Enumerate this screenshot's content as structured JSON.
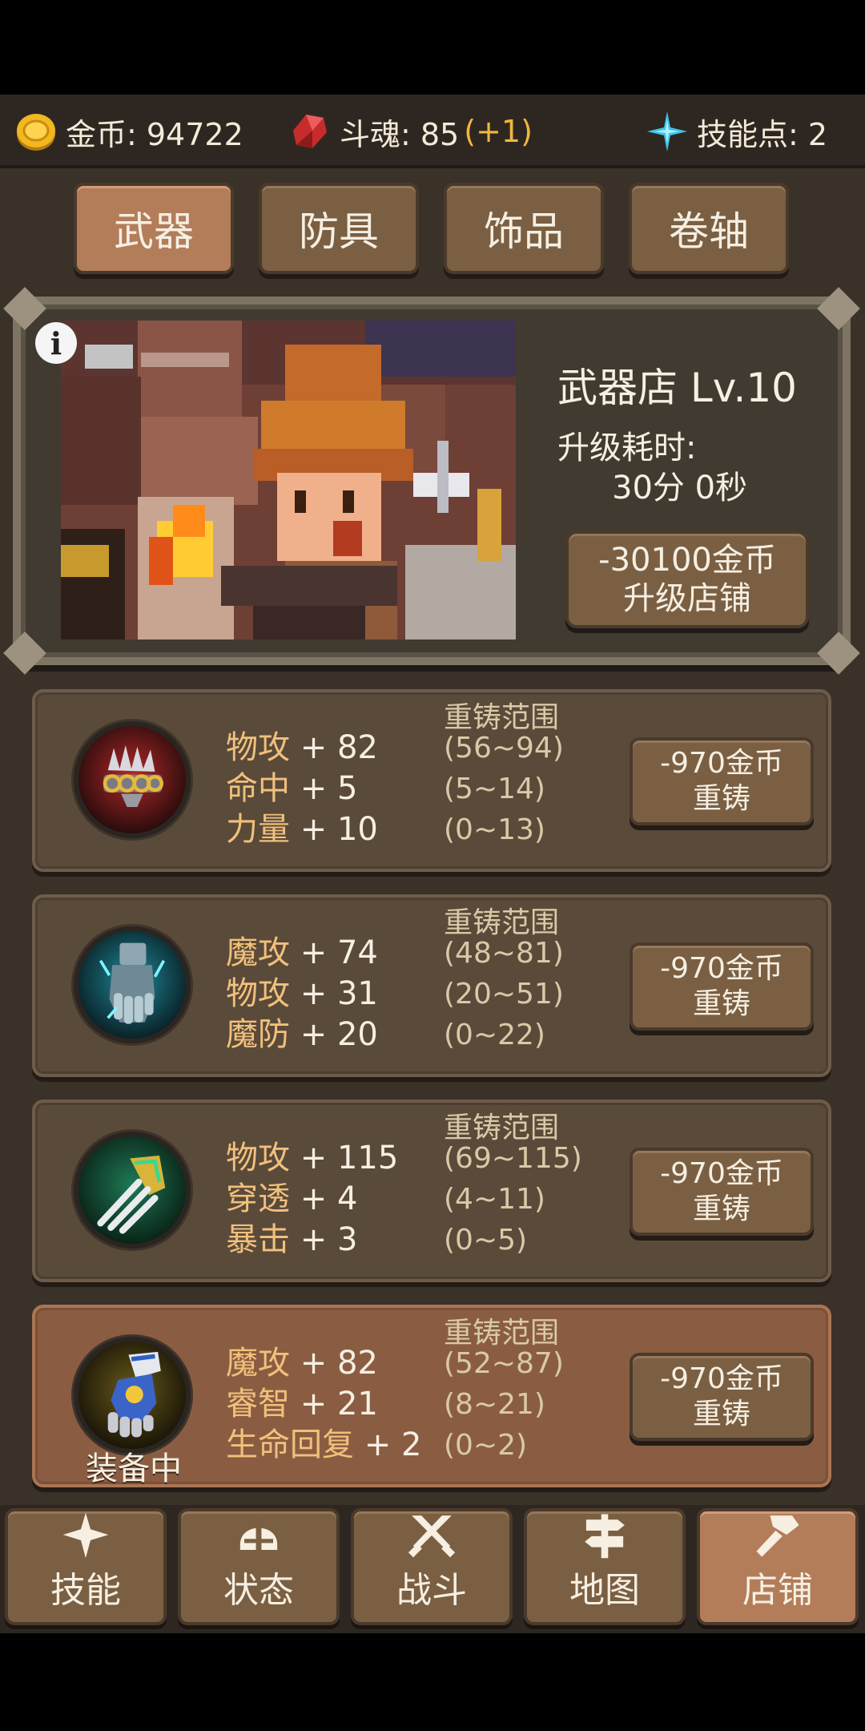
{
  "resources": {
    "gold": {
      "label": "金币: 94722",
      "icon": "gold-coin-icon"
    },
    "soul": {
      "label": "斗魂: 85",
      "bonus": "(+1)",
      "icon": "red-crystal-icon"
    },
    "skill_points": {
      "label": "技能点: 2",
      "icon": "blue-star-icon"
    }
  },
  "tabs": [
    {
      "label": "武器",
      "active": true
    },
    {
      "label": "防具",
      "active": false
    },
    {
      "label": "饰品",
      "active": false
    },
    {
      "label": "卷轴",
      "active": false
    }
  ],
  "shop": {
    "title": "武器店 Lv.10",
    "upgrade_label": "升级耗时:",
    "upgrade_time": "30分 0秒",
    "upgrade_cost": "-30100金币",
    "upgrade_action": "升级店铺",
    "info_icon": "i"
  },
  "items": [
    {
      "icon": "spiked-knuckles-icon",
      "stats": [
        {
          "name": "物攻",
          "value": " + 82"
        },
        {
          "name": "命中",
          "value": " + 5"
        },
        {
          "name": "力量",
          "value": " + 10"
        }
      ],
      "range_header": "重铸范围",
      "ranges": [
        "(56~94)",
        "(5~14)",
        "(0~13)"
      ],
      "cost": "-970金币",
      "action": "重铸",
      "equipped": false
    },
    {
      "icon": "ice-gauntlet-icon",
      "stats": [
        {
          "name": "魔攻",
          "value": " + 74"
        },
        {
          "name": "物攻",
          "value": " + 31"
        },
        {
          "name": "魔防",
          "value": " + 20"
        }
      ],
      "range_header": "重铸范围",
      "ranges": [
        "(48~81)",
        "(20~51)",
        "(0~22)"
      ],
      "cost": "-970金币",
      "action": "重铸",
      "equipped": false
    },
    {
      "icon": "green-claw-icon",
      "stats": [
        {
          "name": "物攻",
          "value": " + 115"
        },
        {
          "name": "穿透",
          "value": " + 4"
        },
        {
          "name": "暴击",
          "value": " + 3"
        }
      ],
      "range_header": "重铸范围",
      "ranges": [
        "(69~115)",
        "(4~11)",
        "(0~5)"
      ],
      "cost": "-970金币",
      "action": "重铸",
      "equipped": false
    },
    {
      "icon": "golden-gauntlet-icon",
      "stats": [
        {
          "name": "魔攻",
          "value": " + 82"
        },
        {
          "name": "睿智",
          "value": " + 21"
        },
        {
          "name": "生命回复",
          "value": " + 2"
        }
      ],
      "range_header": "重铸范围",
      "ranges": [
        "(52~87)",
        "(8~21)",
        "(0~2)"
      ],
      "cost": "-970金币",
      "action": "重铸",
      "equipped": true,
      "equipped_label": "装备中"
    }
  ],
  "nav": [
    {
      "label": "技能",
      "icon": "sparkle-icon",
      "active": false
    },
    {
      "label": "状态",
      "icon": "helmet-icon",
      "active": false
    },
    {
      "label": "战斗",
      "icon": "crossed-swords-icon",
      "active": false
    },
    {
      "label": "地图",
      "icon": "signpost-icon",
      "active": false
    },
    {
      "label": "店铺",
      "icon": "hammer-icon",
      "active": true
    }
  ]
}
